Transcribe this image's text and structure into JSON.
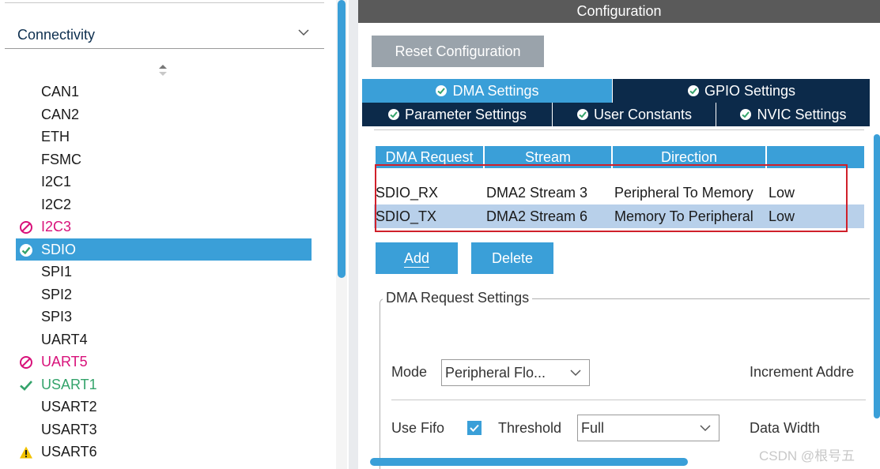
{
  "left_panel": {
    "category": "Connectivity",
    "peripherals": [
      {
        "label": "CAN1",
        "status": "none"
      },
      {
        "label": "CAN2",
        "status": "none"
      },
      {
        "label": "ETH",
        "status": "none"
      },
      {
        "label": "FSMC",
        "status": "none"
      },
      {
        "label": "I2C1",
        "status": "none"
      },
      {
        "label": "I2C2",
        "status": "none"
      },
      {
        "label": "I2C3",
        "status": "error",
        "icon": "prohibited-icon"
      },
      {
        "label": "SDIO",
        "status": "selected",
        "icon": "check-circle-icon"
      },
      {
        "label": "SPI1",
        "status": "none"
      },
      {
        "label": "SPI2",
        "status": "none"
      },
      {
        "label": "SPI3",
        "status": "none"
      },
      {
        "label": "UART4",
        "status": "none"
      },
      {
        "label": "UART5",
        "status": "error",
        "icon": "prohibited-icon"
      },
      {
        "label": "USART1",
        "status": "ok",
        "icon": "checkmark-icon"
      },
      {
        "label": "USART2",
        "status": "none"
      },
      {
        "label": "USART3",
        "status": "none"
      },
      {
        "label": "USART6",
        "status": "warning",
        "icon": "warning-icon"
      }
    ]
  },
  "config": {
    "title": "Configuration",
    "reset_label": "Reset Configuration",
    "tabs": {
      "dma": "DMA Settings",
      "gpio": "GPIO Settings",
      "param": "Parameter Settings",
      "user": "User Constants",
      "nvic": "NVIC Settings"
    },
    "table": {
      "headers": [
        "DMA Request",
        "Stream",
        "Direction",
        ""
      ],
      "rows": [
        {
          "request": "SDIO_RX",
          "stream": "DMA2 Stream 3",
          "direction": "Peripheral To Memory",
          "priority": "Low"
        },
        {
          "request": "SDIO_TX",
          "stream": "DMA2 Stream 6",
          "direction": "Memory To Peripheral",
          "priority": "Low"
        }
      ]
    },
    "add_label": "Add",
    "delete_label": "Delete",
    "request_settings": {
      "title": "DMA Request Settings",
      "mode_label": "Mode",
      "mode_value": "Peripheral Flo...",
      "increment_label": "Increment Addre",
      "use_fifo_label": "Use Fifo",
      "use_fifo_checked": true,
      "threshold_label": "Threshold",
      "threshold_value": "Full",
      "data_width_label": "Data Width"
    }
  },
  "watermark": "CSDN @根号五",
  "colors": {
    "accent": "#3a9fd8",
    "tab_dark": "#0c2a4a",
    "error": "#d8117a",
    "ok": "#34a36b",
    "warning": "#f2c200",
    "highlight_box": "#d0202a"
  }
}
